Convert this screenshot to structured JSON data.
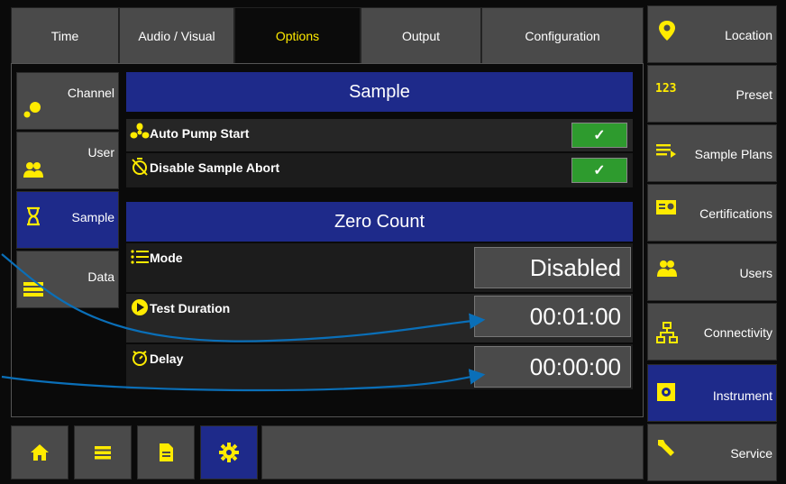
{
  "tabs": [
    {
      "label": "Time",
      "active": false
    },
    {
      "label": "Audio / Visual",
      "active": false
    },
    {
      "label": "Options",
      "active": true
    },
    {
      "label": "Output",
      "active": false
    },
    {
      "label": "Configuration",
      "active": false
    }
  ],
  "left_nav": [
    {
      "label": "Channel",
      "icon": "channel-icon"
    },
    {
      "label": "User",
      "icon": "user-group-icon"
    },
    {
      "label": "Sample",
      "icon": "hourglass-icon",
      "active": true
    },
    {
      "label": "Data",
      "icon": "table-icon"
    }
  ],
  "sample_section": {
    "title": "Sample",
    "rows": [
      {
        "label": "Auto Pump Start",
        "icon": "fan-icon",
        "checked": true,
        "check_glyph": "✓"
      },
      {
        "label": "Disable Sample Abort",
        "icon": "timer-off-icon",
        "checked": true,
        "check_glyph": "✓"
      }
    ]
  },
  "zero_count_section": {
    "title": "Zero Count",
    "rows": [
      {
        "label": "Mode",
        "icon": "list-icon",
        "value": "Disabled"
      },
      {
        "label": "Test Duration",
        "icon": "play-circle-icon",
        "value": "00:01:00"
      },
      {
        "label": "Delay",
        "icon": "timer-icon",
        "value": "00:00:00"
      }
    ]
  },
  "right_nav": [
    {
      "label": "Location",
      "icon": "location-pin-icon"
    },
    {
      "label": "Preset",
      "icon": "numbers-123-icon",
      "icon_text": "123"
    },
    {
      "label": "Sample Plans",
      "icon": "sample-plans-icon"
    },
    {
      "label": "Certifications",
      "icon": "certificate-icon"
    },
    {
      "label": "Users",
      "icon": "users-icon"
    },
    {
      "label": "Connectivity",
      "icon": "network-icon"
    },
    {
      "label": "Instrument",
      "icon": "instrument-icon",
      "active": true
    },
    {
      "label": "Service",
      "icon": "wrench-icon"
    }
  ],
  "bottom_bar": [
    {
      "icon": "home-icon"
    },
    {
      "icon": "list-icon"
    },
    {
      "icon": "document-icon"
    },
    {
      "icon": "gear-icon",
      "active": true
    }
  ],
  "colors": {
    "accent_yellow": "#ffeb00",
    "active_blue": "#1e2a8a",
    "check_green": "#2e9b2e",
    "button_gray": "#4a4a4a",
    "annotation_blue": "#0a6fb8"
  }
}
